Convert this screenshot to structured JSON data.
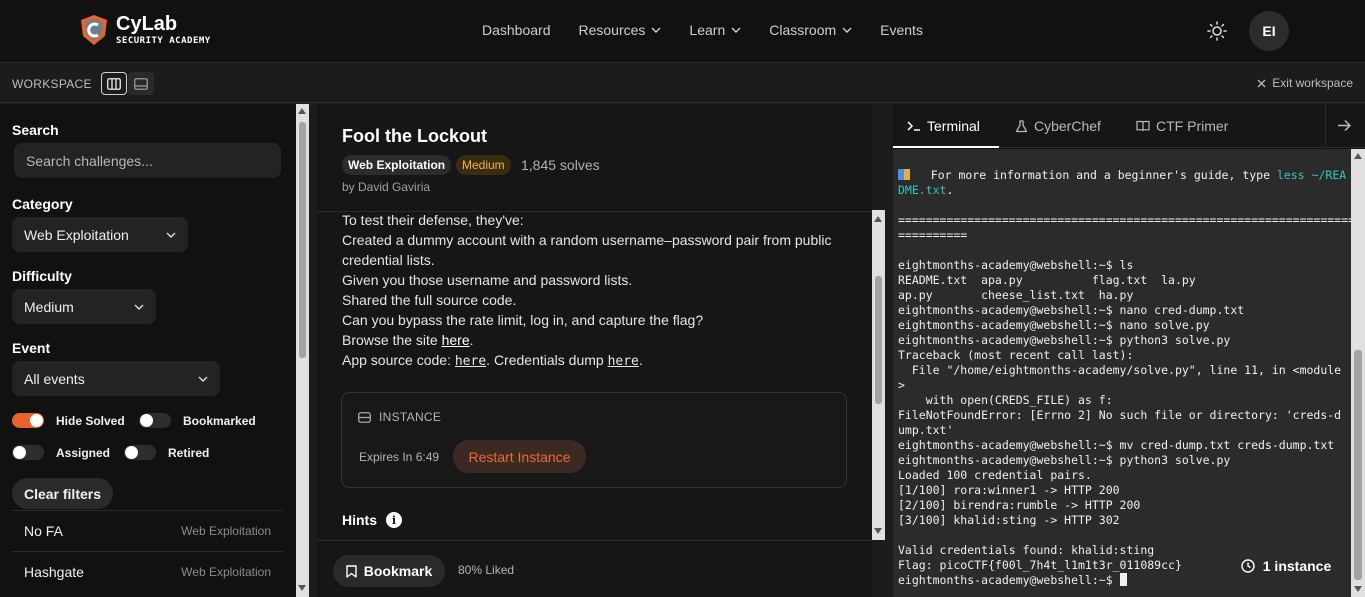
{
  "brand": {
    "name": "CyLab",
    "subtitle": "SECURITY ACADEMY"
  },
  "nav": {
    "items": [
      {
        "label": "Dashboard",
        "dropdown": false
      },
      {
        "label": "Resources",
        "dropdown": true
      },
      {
        "label": "Learn",
        "dropdown": true
      },
      {
        "label": "Classroom",
        "dropdown": true
      },
      {
        "label": "Events",
        "dropdown": false
      }
    ],
    "avatar": "EI"
  },
  "workspace": {
    "label": "WORKSPACE",
    "exit_label": "Exit workspace"
  },
  "sidebar": {
    "search_heading": "Search",
    "search_placeholder": "Search challenges...",
    "category_heading": "Category",
    "category_value": "Web Exploitation",
    "difficulty_heading": "Difficulty",
    "difficulty_value": "Medium",
    "event_heading": "Event",
    "event_value": "All events",
    "toggles": {
      "hide_solved": {
        "label": "Hide Solved",
        "on": true
      },
      "bookmarked": {
        "label": "Bookmarked",
        "on": false
      },
      "assigned": {
        "label": "Assigned",
        "on": false
      },
      "retired": {
        "label": "Retired",
        "on": false
      }
    },
    "clear_filters": "Clear filters",
    "challenges": [
      {
        "name": "No FA",
        "category": "Web Exploitation"
      },
      {
        "name": "Hashgate",
        "category": "Web Exploitation"
      }
    ]
  },
  "challenge": {
    "title": "Fool the Lockout",
    "category": "Web Exploitation",
    "difficulty": "Medium",
    "solves": "1,845 solves",
    "author": "by David Gaviria",
    "desc": {
      "l1": "To test their defense, they've:",
      "l2": "Created a dummy account with a random username–password pair from public credential lists.",
      "l3": "Given you those username and password lists.",
      "l4": "Shared the full source code.",
      "l5": "Can you bypass the rate limit, log in, and capture the flag?",
      "l6_prefix": "Browse the site ",
      "link_here": "here",
      "period": ".",
      "l7_prefix": "App source code: ",
      "l7_mid": ". Credentials dump "
    },
    "instance": {
      "heading": "INSTANCE",
      "expires": "Expires In 6:49",
      "restart": "Restart Instance"
    },
    "hints": "Hints",
    "bookmark": "Bookmark",
    "liked": "80% Liked"
  },
  "terminal_tabs": [
    {
      "label": "Terminal",
      "active": true
    },
    {
      "label": "CyberChef",
      "active": false
    },
    {
      "label": "CTF Primer",
      "active": false
    }
  ],
  "terminal": {
    "line_info": "   For more information and a beginner's guide, type ",
    "cmd_hint": "less ~/REA\nDME.txt",
    "after_hint": ".",
    "body": "\n\n==================================================================\n==========\n\neightmonths-academy@webshell:~$ ls\nREADME.txt  apa.py          flag.txt  la.py\nap.py       cheese_list.txt  ha.py\neightmonths-academy@webshell:~$ nano cred-dump.txt\neightmonths-academy@webshell:~$ nano solve.py\neightmonths-academy@webshell:~$ python3 solve.py\nTraceback (most recent call last):\n  File \"/home/eightmonths-academy/solve.py\", line 11, in <module\n>\n    with open(CREDS_FILE) as f:\nFileNotFoundError: [Errno 2] No such file or directory: 'creds-d\nump.txt'\neightmonths-academy@webshell:~$ mv cred-dump.txt creds-dump.txt\neightmonths-academy@webshell:~$ python3 solve.py\nLoaded 100 credential pairs.\n[1/100] rora:winner1 -> HTTP 200\n[2/100] birendra:rumble -> HTTP 200\n[3/100] khalid:sting -> HTTP 302\n\nValid credentials found: khalid:sting\nFlag: picoCTF{f00l_7h4t_l1m1t3r_011089cc}\neightmonths-academy@webshell:~$ ",
    "instance_pill": "1 instance"
  },
  "colors": {
    "accent": "#e8632a",
    "medium": "#f0b640",
    "cyan": "#34c3c3"
  }
}
